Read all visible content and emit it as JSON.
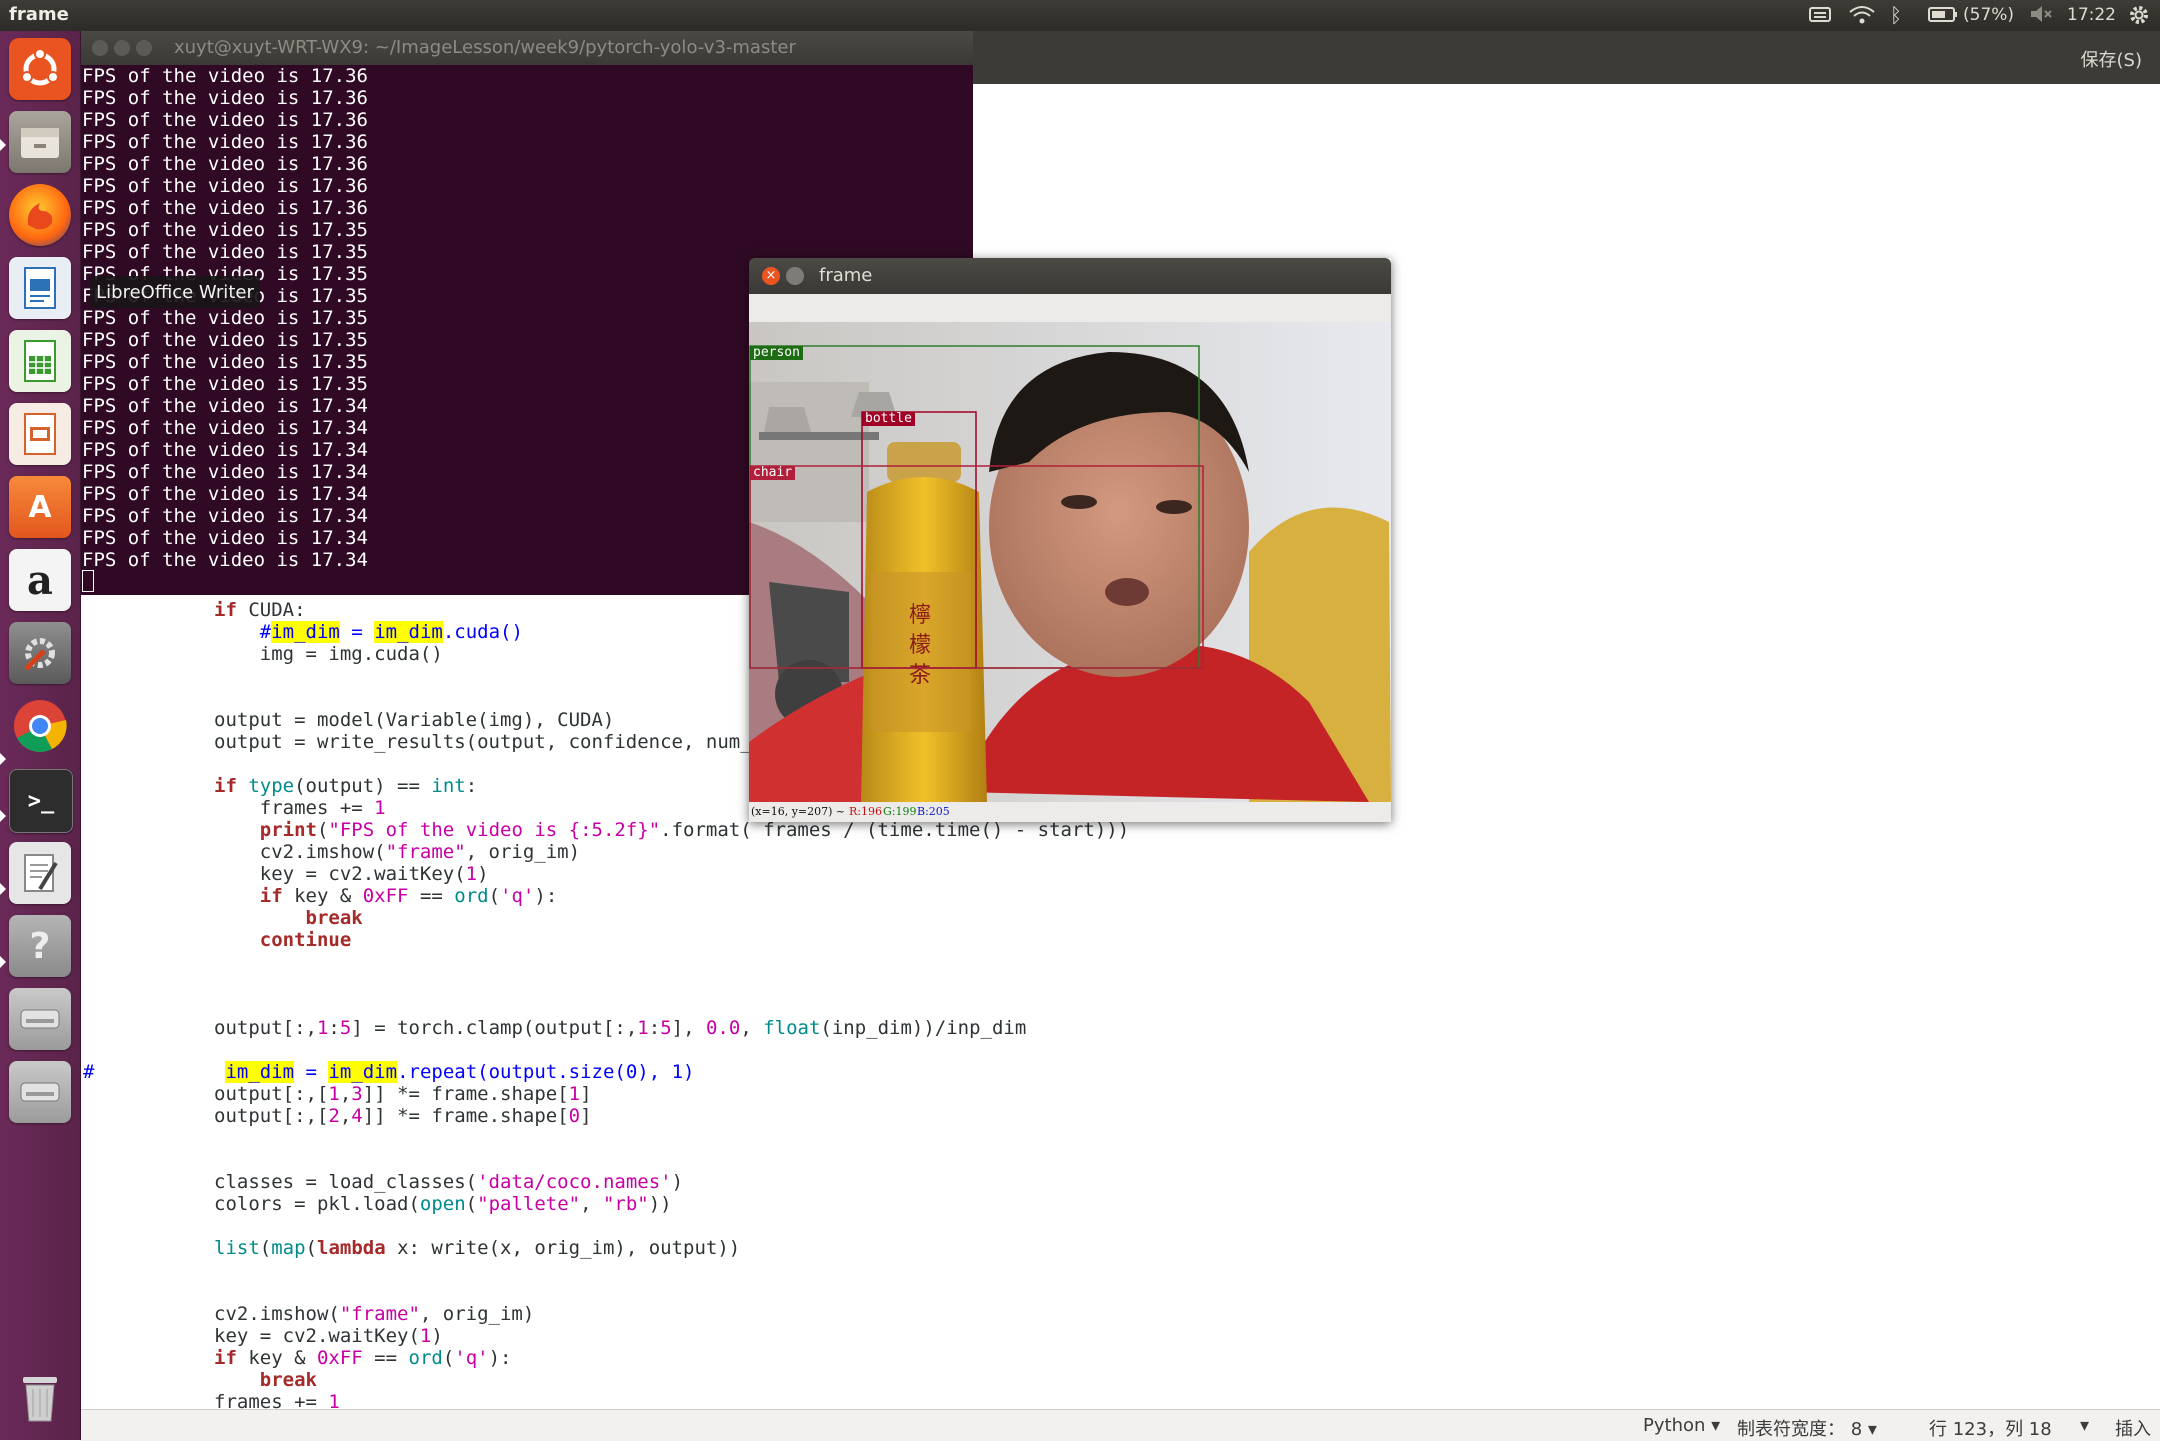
{
  "top_panel": {
    "title": "frame",
    "battery": "(57%)",
    "clock": "17:22"
  },
  "tooltip": "LibreOffice Writer",
  "terminal": {
    "title": "xuyt@xuyt-WRT-WX9: ~/ImageLesson/week9/pytorch-yolo-v3-master",
    "lines": [
      "FPS of the video is 17.36",
      "FPS of the video is 17.36",
      "FPS of the video is 17.36",
      "FPS of the video is 17.36",
      "FPS of the video is 17.36",
      "FPS of the video is 17.36",
      "FPS of the video is 17.36",
      "FPS of the video is 17.35",
      "FPS of the video is 17.35",
      "FPS of the video is 17.35",
      "FPS of the video is 17.35",
      "FPS of the video is 17.35",
      "FPS of the video is 17.35",
      "FPS of the video is 17.35",
      "FPS of the video is 17.35",
      "FPS of the video is 17.34",
      "FPS of the video is 17.34",
      "FPS of the video is 17.34",
      "FPS of the video is 17.34",
      "FPS of the video is 17.34",
      "FPS of the video is 17.34",
      "FPS of the video is 17.34",
      "FPS of the video is 17.34"
    ]
  },
  "gedit": {
    "save_label": "保存(S)"
  },
  "frame_window": {
    "title": "frame",
    "status_coords": "(x=16, y=207) ~",
    "status_r": "R:196",
    "status_g": "G:199",
    "status_b": "B:205",
    "detections": [
      {
        "label": "person"
      },
      {
        "label": "bottle"
      },
      {
        "label": "chair"
      }
    ]
  },
  "statusbar": {
    "language": "Python",
    "tab_width": "制表符宽度： 8",
    "position": "行 123，列 18",
    "mode": "插入"
  },
  "colors": {
    "terminal_bg": "#300a24",
    "launcher_bg": "#5e2750",
    "person_box": "#2e7d2e",
    "bottle_box": "#a00025",
    "chair_box": "#b0203a"
  }
}
